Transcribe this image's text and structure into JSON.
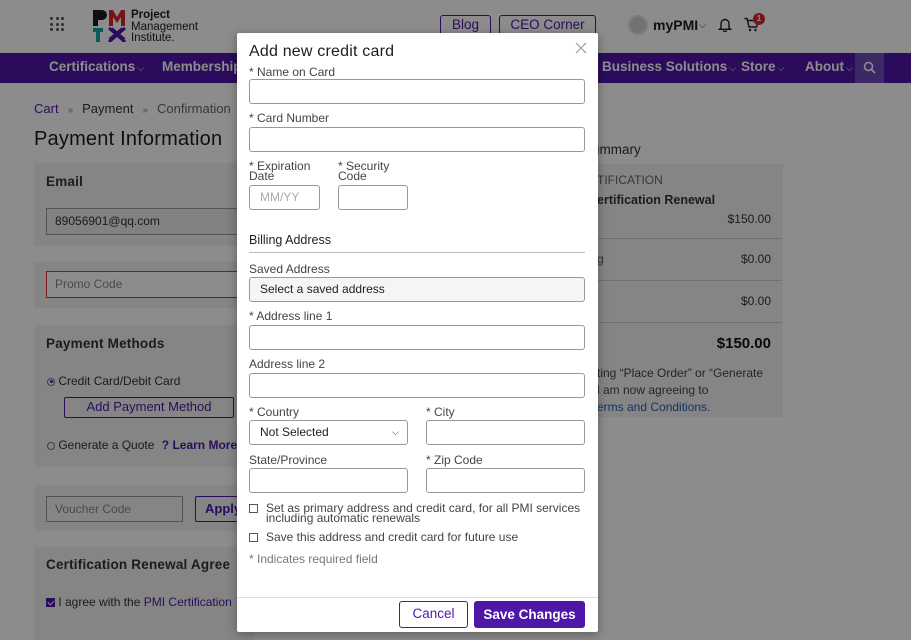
{
  "header": {
    "logo_line1": "Project",
    "logo_line2": "Management",
    "logo_line3": "Institute.",
    "blog": "Blog",
    "ceo_corner": "CEO Corner",
    "mypmi": "myPMI",
    "cart_count": "1"
  },
  "nav": {
    "items": [
      "Certifications",
      "Membership",
      "Business Solutions",
      "Store",
      "About"
    ]
  },
  "breadcrumb": {
    "cart": "Cart",
    "payment": "Payment",
    "confirmation": "Confirmation"
  },
  "page_title": "Payment Information",
  "email_section": {
    "heading": "Email",
    "value": "89056901@qq.com"
  },
  "promo": {
    "placeholder": "Promo Code"
  },
  "payment_methods": {
    "heading": "Payment Methods",
    "credit_option": "Credit Card/Debit Card",
    "add_button": "Add Payment Method",
    "quote_option": "Generate a Quote",
    "learn_more": "Learn More"
  },
  "voucher": {
    "placeholder": "Voucher Code",
    "apply": "Apply"
  },
  "renewal": {
    "heading": "Certification Renewal Agree",
    "agree_text": "I agree with the",
    "agree_link": "PMI Certification"
  },
  "summary": {
    "heading": "ummary",
    "category": "TIFICATION",
    "item": "ertification Renewal",
    "item_price": "$150.00",
    "row2_label": "g",
    "row2_value": "$0.00",
    "row3_value": "$0.00",
    "total": "$150.00",
    "note_line1": "ting “Place Order” or “Generate",
    "note_line2": "l am now agreeing to",
    "terms_link": "erms and Conditions."
  },
  "modal": {
    "title": "Add new credit card",
    "name_label": "* Name on Card",
    "number_label": "* Card Number",
    "exp_label_1": "* Expiration",
    "exp_label_2": "Date",
    "exp_placeholder": "MM/YY",
    "sec_label_1": "* Security",
    "sec_label_2": "Code",
    "billing_heading": "Billing Address",
    "saved_label": "Saved Address",
    "saved_value": "Select a saved address",
    "addr1_label": "* Address line 1",
    "addr2_label": "Address line 2",
    "country_label": "* Country",
    "country_value": "Not Selected",
    "city_label": "* City",
    "state_label": "State/Province",
    "zip_label": "* Zip Code",
    "primary_check_line1": "Set as primary address and credit card, for all PMI services",
    "primary_check_line2": "including automatic renewals",
    "save_check": "Save this address and credit card for future use",
    "required_note": "* Indicates required field",
    "cancel": "Cancel",
    "save": "Save Changes"
  }
}
